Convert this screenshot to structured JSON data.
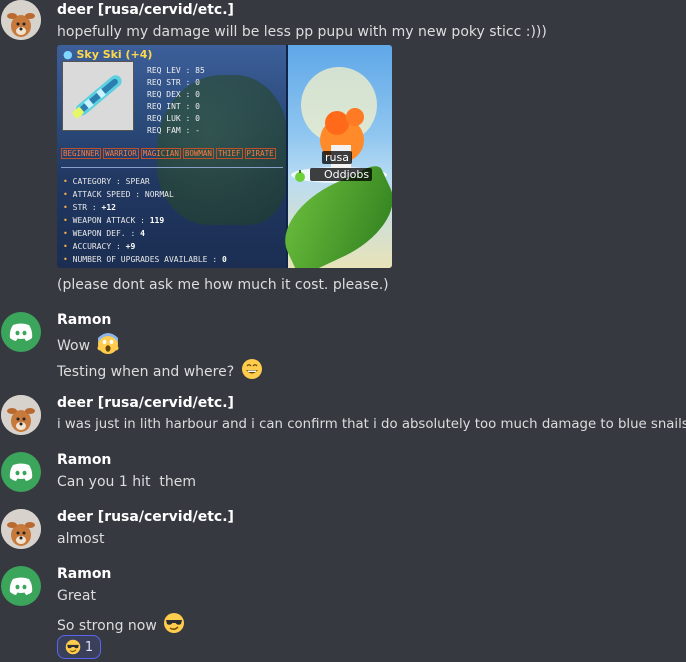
{
  "messages": [
    {
      "author": "deer [rusa/cervid/etc.]",
      "lines": [
        "hopefully my damage will be less pp pupu with my new poky sticc :)))"
      ],
      "attachment": {
        "item_title": "Sky Ski (+4)",
        "req": [
          "REQ LEV : 85",
          "REQ STR : 0",
          "REQ DEX : 0",
          "REQ INT : 0",
          "REQ LUK : 0",
          "REQ FAM : -"
        ],
        "jobs": [
          "BEGINNER",
          "WARRIOR",
          "MAGICIAN",
          "BOWMAN",
          "THIEF",
          "PIRATE"
        ],
        "stats": [
          {
            "label": "CATEGORY : ",
            "value": "SPEAR"
          },
          {
            "label": "ATTACK SPEED : ",
            "value": "NORMAL"
          },
          {
            "label": "STR : ",
            "value": "+12"
          },
          {
            "label": "WEAPON ATTACK : ",
            "value": "119"
          },
          {
            "label": "WEAPON DEF. : ",
            "value": "4"
          },
          {
            "label": "ACCURACY : ",
            "value": "+9"
          },
          {
            "label": "NUMBER OF UPGRADES AVAILABLE : ",
            "value": "0"
          }
        ],
        "name_tags": [
          "rusa",
          "Oddjobs"
        ]
      },
      "after_text": "(please dont ask me how much it cost. please.)"
    },
    {
      "author": "Ramon",
      "lines": [
        "Wow",
        "Testing when and where?"
      ]
    },
    {
      "author": "deer [rusa/cervid/etc.]",
      "lines": [
        "i was just in lith harbour and i can confirm that i do absolutely too much damage to blue snails"
      ]
    },
    {
      "author": "Ramon",
      "lines": [
        "Can you 1 hit  them"
      ]
    },
    {
      "author": "deer [rusa/cervid/etc.]",
      "lines": [
        "almost"
      ]
    },
    {
      "author": "Ramon",
      "lines": [
        "Great",
        "So strong now"
      ],
      "reaction": {
        "emoji": "sunglasses-emoji",
        "count": "1"
      }
    }
  ],
  "colors": {
    "background": "#36393f",
    "author": "#ffffff",
    "text": "#dcddde",
    "discord_avatar": "#3ba55c",
    "reaction_border": "#5865f2"
  }
}
